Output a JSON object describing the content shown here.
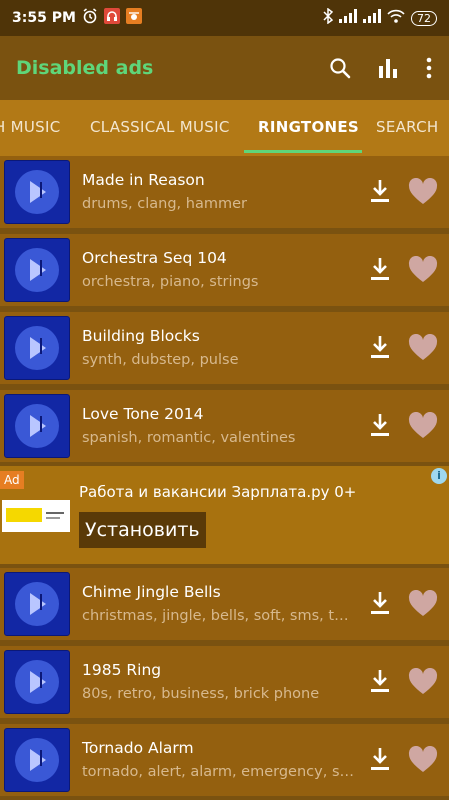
{
  "status": {
    "time": "3:55 PM",
    "battery": "72"
  },
  "app": {
    "title": "Disabled ads",
    "title_color": "#5fd67a",
    "actions": [
      "search-icon",
      "equalizer-icon",
      "more-vert-icon"
    ]
  },
  "tabs": [
    {
      "label": "H MUSIC"
    },
    {
      "label": "CLASSICAL MUSIC"
    },
    {
      "label": "RINGTONES",
      "active": true
    },
    {
      "label": "SEARCH"
    }
  ],
  "ringtones": [
    {
      "title": "Made in Reason",
      "tags": "drums, clang, hammer"
    },
    {
      "title": "Orchestra Seq 104",
      "tags": "orchestra, piano, strings"
    },
    {
      "title": "Building Blocks",
      "tags": "synth, dubstep, pulse"
    },
    {
      "title": "Love Tone 2014",
      "tags": "spanish, romantic, valentines"
    },
    {
      "title": "Chime Jingle Bells",
      "tags": "christmas, jingle, bells, soft, sms, tex..."
    },
    {
      "title": "1985 Ring",
      "tags": "80s, retro, business, brick phone"
    },
    {
      "title": "Tornado Alarm",
      "tags": "tornado, alert, alarm, emergency, sire..."
    }
  ],
  "ad": {
    "badge": "Ad",
    "info": "i",
    "title": "Работа и вакансии Зарплата.ру 0+",
    "button": "Установить"
  },
  "colors": {
    "background": "#7a5210",
    "tab_bar": "#b27916",
    "row": "#94600f",
    "accent": "#5fd67a",
    "heart": "#cfa7a2"
  }
}
